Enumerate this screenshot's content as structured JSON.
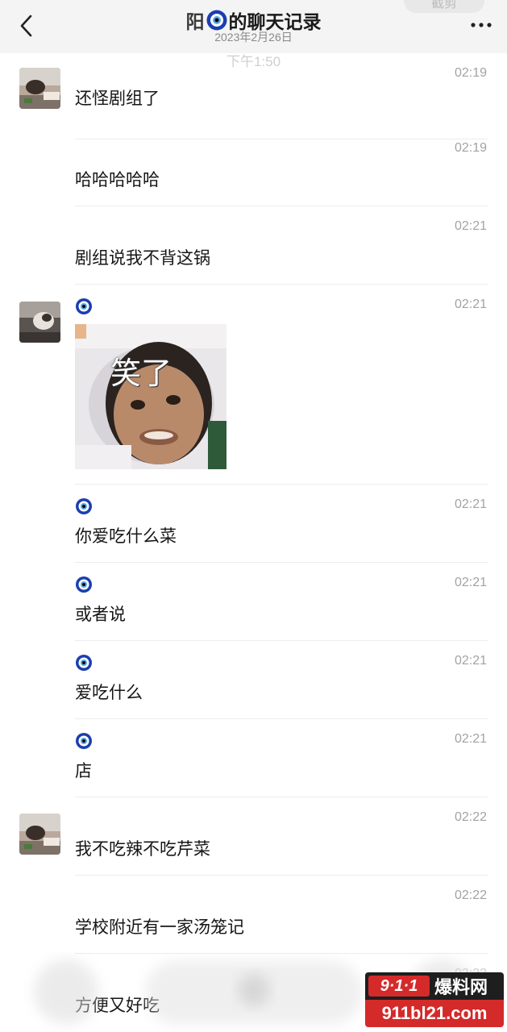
{
  "header": {
    "title_prefix": "阳",
    "title_suffix": "的聊天记录",
    "subtitle": "2023年2月26日",
    "ghost_pill": "截剪",
    "ghost_time": "下午1:50"
  },
  "messages": [
    {
      "time": "02:19",
      "text": "还怪剧组了",
      "avatar": true,
      "badge": false
    },
    {
      "time": "02:19",
      "text": "哈哈哈哈哈",
      "avatar": false,
      "badge": false
    },
    {
      "time": "02:21",
      "text": "剧组说我不背这锅",
      "avatar": false,
      "badge": false
    },
    {
      "time": "02:21",
      "text": "",
      "sticker_caption": "笑了",
      "avatar": true,
      "badge": true
    },
    {
      "time": "02:21",
      "text": "你爱吃什么菜",
      "avatar": false,
      "badge": true
    },
    {
      "time": "02:21",
      "text": "或者说",
      "avatar": false,
      "badge": true
    },
    {
      "time": "02:21",
      "text": "爱吃什么",
      "avatar": false,
      "badge": true
    },
    {
      "time": "02:21",
      "text": "店",
      "avatar": false,
      "badge": true
    },
    {
      "time": "02:22",
      "text": "我不吃辣不吃芹菜",
      "avatar": true,
      "badge": false
    },
    {
      "time": "02:22",
      "text": "学校附近有一家汤笼记",
      "avatar": false,
      "badge": false
    },
    {
      "time": "02:22",
      "text": "方便又好吃",
      "avatar": false,
      "badge": false
    }
  ],
  "watermark": {
    "logo_text": "9·1·1",
    "name_text": "爆料网",
    "url_text": "911bl21.com"
  },
  "colors": {
    "header_bg": "#f4f4f4",
    "time_text": "#a3a3a3",
    "badge_blue": "#1a3fb0",
    "watermark_red": "#d42a2a"
  }
}
